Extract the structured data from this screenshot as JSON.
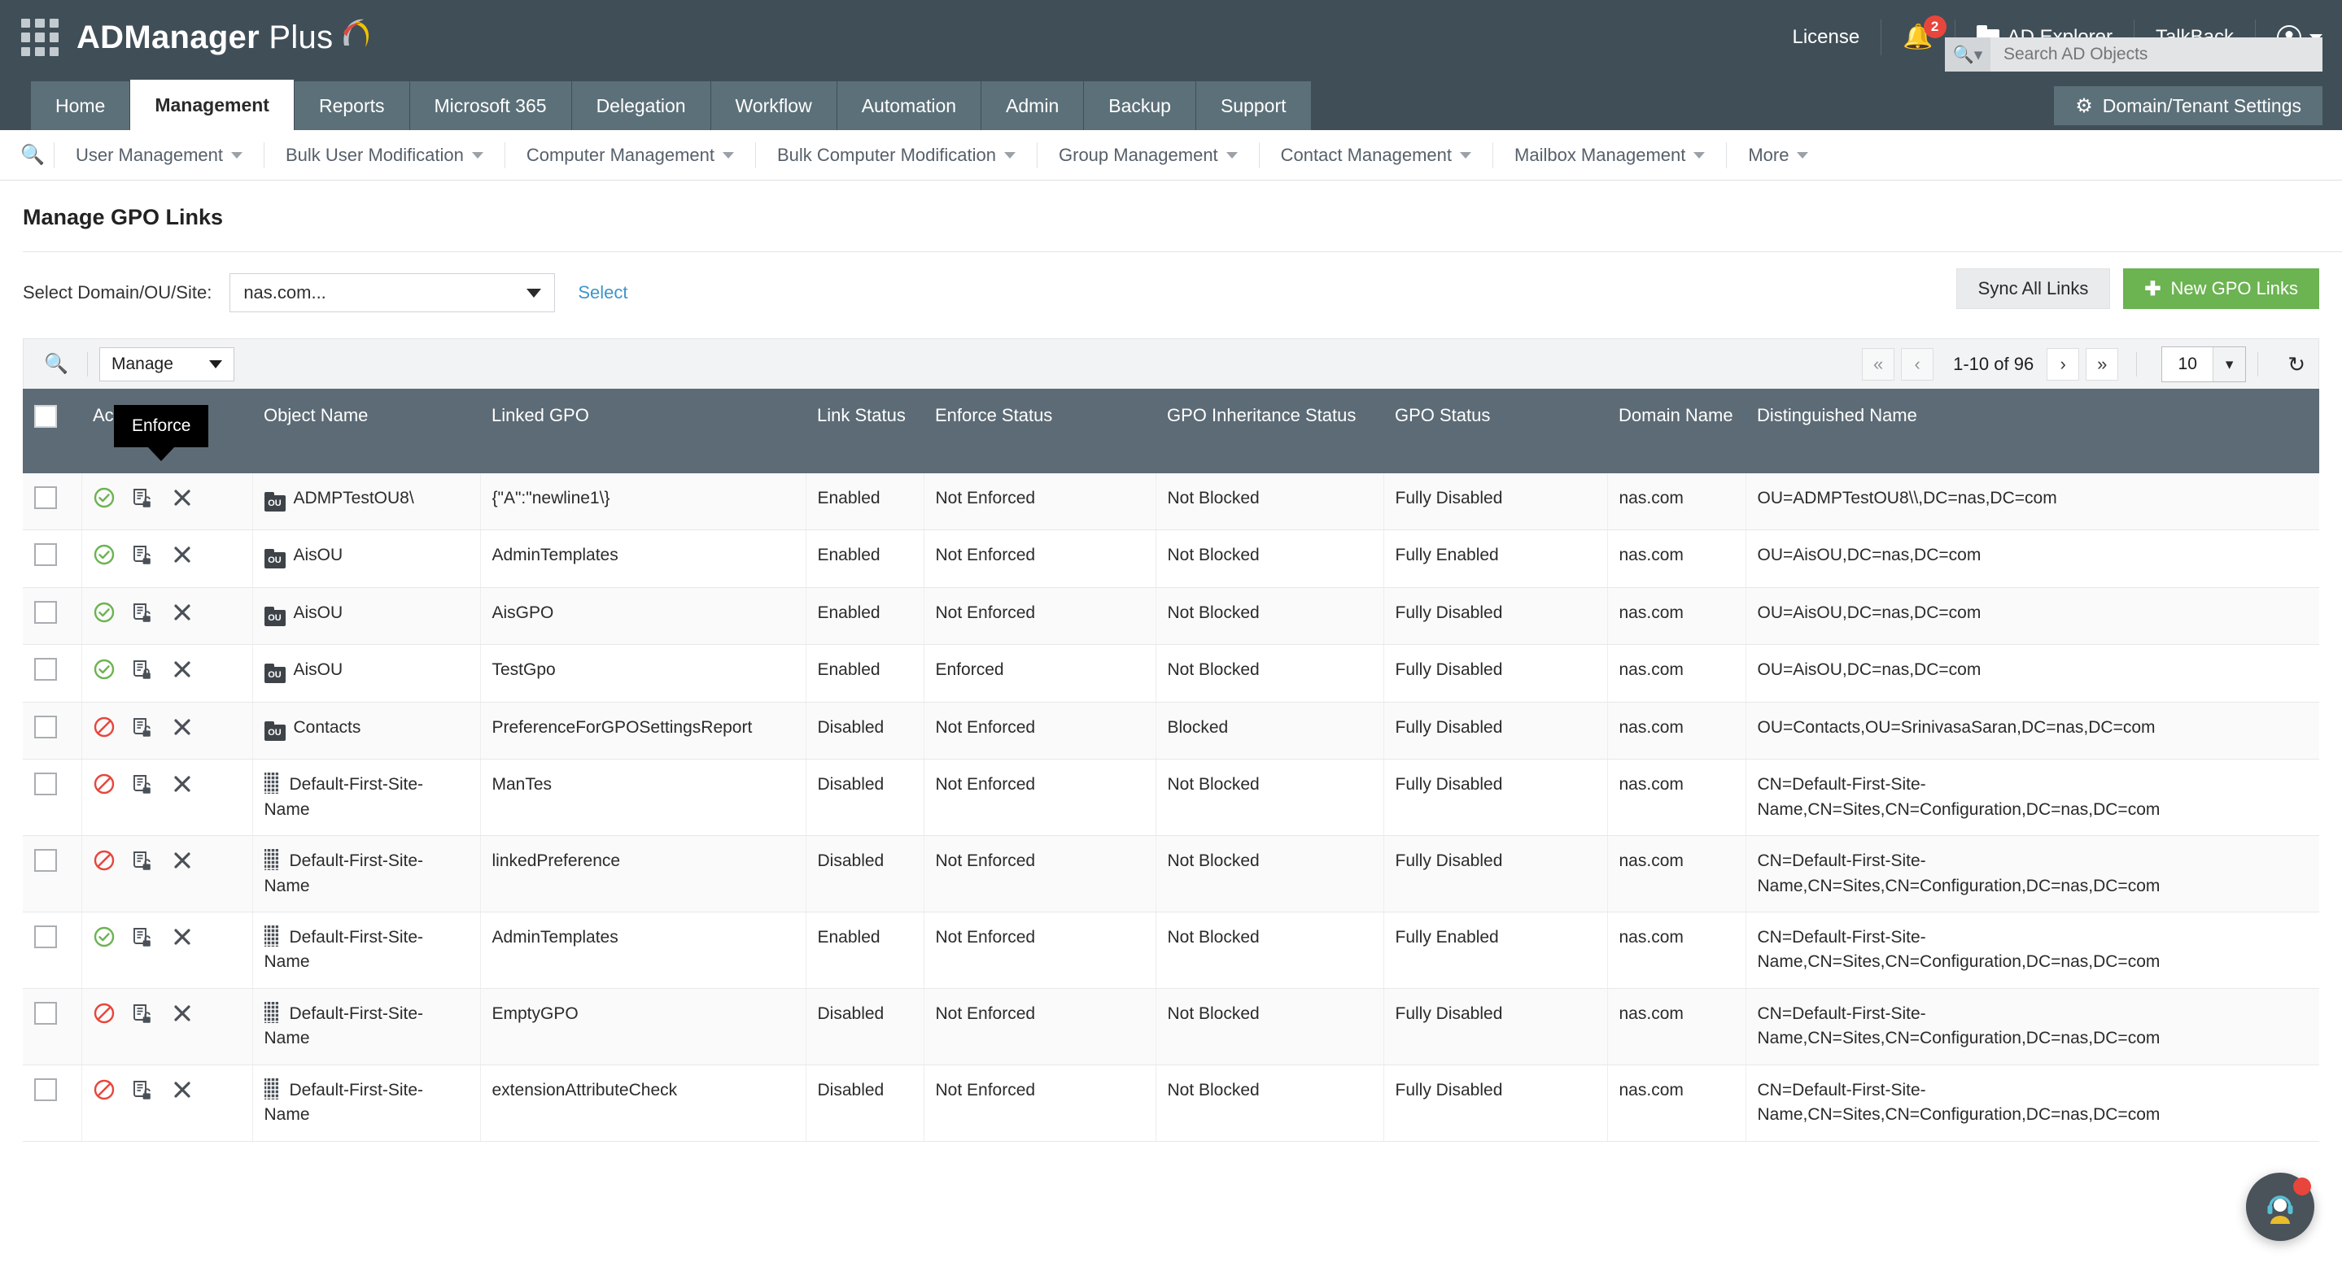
{
  "header": {
    "brand_ad": "AD",
    "brand_manager": "Manager",
    "brand_plus": "Plus",
    "waffle_icon": "grid-apps-icon",
    "license": "License",
    "notifications_icon": "bell-icon",
    "notifications_count": "2",
    "ad_explorer_icon": "folder-icon",
    "ad_explorer": "AD Explorer",
    "talkback": "TalkBack",
    "account_icon": "user-avatar-icon",
    "account_caret_icon": "chevron-down-icon",
    "search_icon": "search-icon",
    "search_placeholder": "Search AD Objects",
    "search_value": ""
  },
  "main_nav": {
    "tabs": [
      {
        "label": "Home",
        "active": false
      },
      {
        "label": "Management",
        "active": true
      },
      {
        "label": "Reports",
        "active": false
      },
      {
        "label": "Microsoft 365",
        "active": false
      },
      {
        "label": "Delegation",
        "active": false
      },
      {
        "label": "Workflow",
        "active": false
      },
      {
        "label": "Automation",
        "active": false
      },
      {
        "label": "Admin",
        "active": false
      },
      {
        "label": "Backup",
        "active": false
      },
      {
        "label": "Support",
        "active": false
      }
    ],
    "domain_tenant_settings": "Domain/Tenant Settings",
    "domain_tenant_settings_icon": "gear-icon"
  },
  "sub_nav": {
    "search_icon": "search-list-icon",
    "items": [
      {
        "label": "User Management"
      },
      {
        "label": "Bulk User Modification"
      },
      {
        "label": "Computer Management"
      },
      {
        "label": "Bulk Computer Modification"
      },
      {
        "label": "Group Management"
      },
      {
        "label": "Contact Management"
      },
      {
        "label": "Mailbox Management"
      },
      {
        "label": "More"
      }
    ]
  },
  "page": {
    "title": "Manage GPO Links",
    "select_label": "Select Domain/OU/Site:",
    "domain_value": "nas.com...",
    "select_link": "Select",
    "sync_all_links": "Sync All Links",
    "new_gpo_links": "New GPO Links",
    "new_gpo_links_icon": "plus-icon"
  },
  "toolbar": {
    "search_icon": "search-list-icon",
    "manage_label": "Manage",
    "manage_caret_icon": "caret-down-icon",
    "first_page_icon": "«",
    "prev_page_icon": "‹",
    "range_text": "1-10 of 96",
    "next_page_icon": "›",
    "last_page_icon": "»",
    "page_size": "10",
    "page_size_caret_icon": "chevron-down-icon",
    "refresh_icon": "refresh-icon"
  },
  "tooltip": {
    "text": "Enforce"
  },
  "table": {
    "columns": [
      "",
      "Actions",
      "Object Name",
      "Linked GPO",
      "Link Status",
      "Enforce Status",
      "GPO Inheritance Status",
      "GPO Status",
      "Domain Name",
      "Distinguished Name"
    ],
    "action_icons": {
      "status_enabled": "green-check-circle-icon",
      "status_disabled": "red-prohibited-icon",
      "enforce_unlocked": "document-unlocked-icon",
      "enforce_locked": "document-locked-icon",
      "remove": "close-x-icon"
    },
    "rows": [
      {
        "selected": false,
        "link_state": "enabled",
        "enforce_state": "unlocked",
        "object_type": "ou",
        "object_name": "ADMPTestOU8\\",
        "linked_gpo": "{\"A\":\"newline1\\}",
        "link_status": "Enabled",
        "enforce_status": "Not Enforced",
        "inheritance_status": "Not Blocked",
        "gpo_status": "Fully Disabled",
        "domain_name": "nas.com",
        "distinguished_name": "OU=ADMPTestOU8\\\\,DC=nas,DC=com"
      },
      {
        "selected": false,
        "link_state": "enabled",
        "enforce_state": "unlocked",
        "object_type": "ou",
        "object_name": "AisOU",
        "linked_gpo": "AdminTemplates",
        "link_status": "Enabled",
        "enforce_status": "Not Enforced",
        "inheritance_status": "Not Blocked",
        "gpo_status": "Fully Enabled",
        "domain_name": "nas.com",
        "distinguished_name": "OU=AisOU,DC=nas,DC=com"
      },
      {
        "selected": false,
        "link_state": "enabled",
        "enforce_state": "unlocked",
        "object_type": "ou",
        "object_name": "AisOU",
        "linked_gpo": "AisGPO",
        "link_status": "Enabled",
        "enforce_status": "Not Enforced",
        "inheritance_status": "Not Blocked",
        "gpo_status": "Fully Disabled",
        "domain_name": "nas.com",
        "distinguished_name": "OU=AisOU,DC=nas,DC=com"
      },
      {
        "selected": false,
        "link_state": "enabled",
        "enforce_state": "locked",
        "object_type": "ou",
        "object_name": "AisOU",
        "linked_gpo": "TestGpo",
        "link_status": "Enabled",
        "enforce_status": "Enforced",
        "inheritance_status": "Not Blocked",
        "gpo_status": "Fully Disabled",
        "domain_name": "nas.com",
        "distinguished_name": "OU=AisOU,DC=nas,DC=com"
      },
      {
        "selected": false,
        "link_state": "disabled",
        "enforce_state": "unlocked",
        "object_type": "ou",
        "object_name": "Contacts",
        "linked_gpo": "PreferenceForGPOSettingsReport",
        "link_status": "Disabled",
        "enforce_status": "Not Enforced",
        "inheritance_status": "Blocked",
        "gpo_status": "Fully Disabled",
        "domain_name": "nas.com",
        "distinguished_name": "OU=Contacts,OU=SrinivasaSaran,DC=nas,DC=com"
      },
      {
        "selected": false,
        "link_state": "disabled",
        "enforce_state": "unlocked",
        "object_type": "site",
        "object_name": "Default-First-Site-Name",
        "linked_gpo": "ManTes",
        "link_status": "Disabled",
        "enforce_status": "Not Enforced",
        "inheritance_status": "Not Blocked",
        "gpo_status": "Fully Disabled",
        "domain_name": "nas.com",
        "distinguished_name": "CN=Default-First-Site-Name,CN=Sites,CN=Configuration,DC=nas,DC=com"
      },
      {
        "selected": false,
        "link_state": "disabled",
        "enforce_state": "unlocked",
        "object_type": "site",
        "object_name": "Default-First-Site-Name",
        "linked_gpo": "linkedPreference",
        "link_status": "Disabled",
        "enforce_status": "Not Enforced",
        "inheritance_status": "Not Blocked",
        "gpo_status": "Fully Disabled",
        "domain_name": "nas.com",
        "distinguished_name": "CN=Default-First-Site-Name,CN=Sites,CN=Configuration,DC=nas,DC=com"
      },
      {
        "selected": false,
        "link_state": "enabled",
        "enforce_state": "unlocked",
        "object_type": "site",
        "object_name": "Default-First-Site-Name",
        "linked_gpo": "AdminTemplates",
        "link_status": "Enabled",
        "enforce_status": "Not Enforced",
        "inheritance_status": "Not Blocked",
        "gpo_status": "Fully Enabled",
        "domain_name": "nas.com",
        "distinguished_name": "CN=Default-First-Site-Name,CN=Sites,CN=Configuration,DC=nas,DC=com"
      },
      {
        "selected": false,
        "link_state": "disabled",
        "enforce_state": "unlocked",
        "object_type": "site",
        "object_name": "Default-First-Site-Name",
        "linked_gpo": "EmptyGPO",
        "link_status": "Disabled",
        "enforce_status": "Not Enforced",
        "inheritance_status": "Not Blocked",
        "gpo_status": "Fully Disabled",
        "domain_name": "nas.com",
        "distinguished_name": "CN=Default-First-Site-Name,CN=Sites,CN=Configuration,DC=nas,DC=com"
      },
      {
        "selected": false,
        "link_state": "disabled",
        "enforce_state": "unlocked",
        "object_type": "site",
        "object_name": "Default-First-Site-Name",
        "linked_gpo": "extensionAttributeCheck",
        "link_status": "Disabled",
        "enforce_status": "Not Enforced",
        "inheritance_status": "Not Blocked",
        "gpo_status": "Fully Disabled",
        "domain_name": "nas.com",
        "distinguished_name": "CN=Default-First-Site-Name,CN=Sites,CN=Configuration,DC=nas,DC=com"
      }
    ]
  },
  "support_chat": {
    "icon": "headset-support-icon",
    "has_notification": true
  },
  "colors": {
    "header_bg": "#404e57",
    "nav_tab_bg": "#5c7079",
    "table_header_bg": "#5c6b75",
    "accent_green": "#6cb352",
    "link_blue": "#3f95c9",
    "status_enabled": "#6cb352",
    "status_disabled": "#e8453c"
  }
}
